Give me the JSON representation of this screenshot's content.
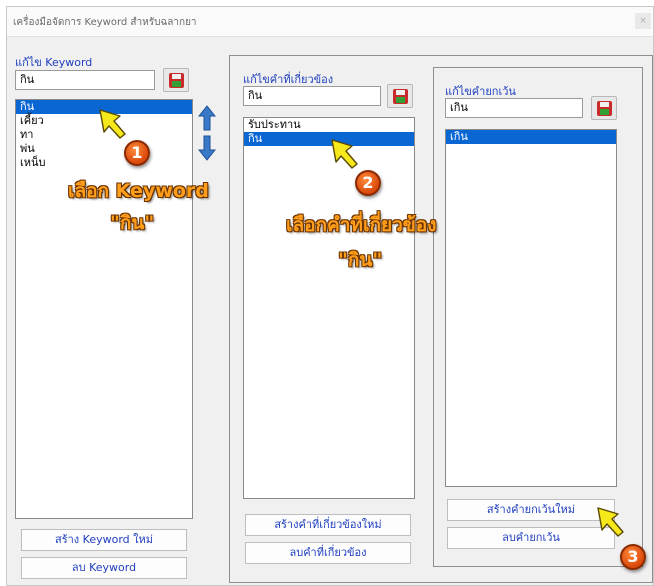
{
  "window": {
    "title": "เครื่องมือจัดการ Keyword สำหรับฉลากยา",
    "close_label": "×"
  },
  "keyword_panel": {
    "label": "แก้ไข Keyword",
    "input_value": "กิน",
    "items": [
      {
        "text": "กิน",
        "selected": true
      },
      {
        "text": "เคี้ยว",
        "selected": false
      },
      {
        "text": "ทา",
        "selected": false
      },
      {
        "text": "พ่น",
        "selected": false
      },
      {
        "text": "เหน็บ",
        "selected": false
      }
    ],
    "create_button": "สร้าง Keyword ใหม่",
    "delete_button": "ลบ Keyword"
  },
  "related_panel": {
    "label": "แก้ไขคำที่เกี่ยวข้อง",
    "input_value": "กิน",
    "items": [
      {
        "text": "รับประทาน",
        "selected": false
      },
      {
        "text": "กิน",
        "selected": true
      }
    ],
    "create_button": "สร้างคำที่เกี่ยวข้องใหม่",
    "delete_button": "ลบคำที่เกี่ยวข้อง"
  },
  "exception_panel": {
    "label": "แก้ไขคำยกเว้น",
    "input_value": "เกิน",
    "items": [
      {
        "text": "เกิน",
        "selected": true
      }
    ],
    "create_button": "สร้างคำยกเว้นใหม่",
    "delete_button": "ลบคำยกเว้น"
  },
  "annotations": {
    "step1_badge": "1",
    "step1_line1": "เลือก Keyword",
    "step1_line2": "\"กิน\"",
    "step2_badge": "2",
    "step2_line1": "เลือกคำที่เกี่ยวข้อง",
    "step2_line2": "\"กิน\"",
    "step3_badge": "3"
  },
  "colors": {
    "selection": "#0a66d3",
    "label_blue": "#1f3fbf",
    "callout_orange": "#ff9e1b",
    "badge_orange": "#e2520e",
    "pointer_yellow": "#f7e81c",
    "arrow_blue": "#3a78c8"
  }
}
